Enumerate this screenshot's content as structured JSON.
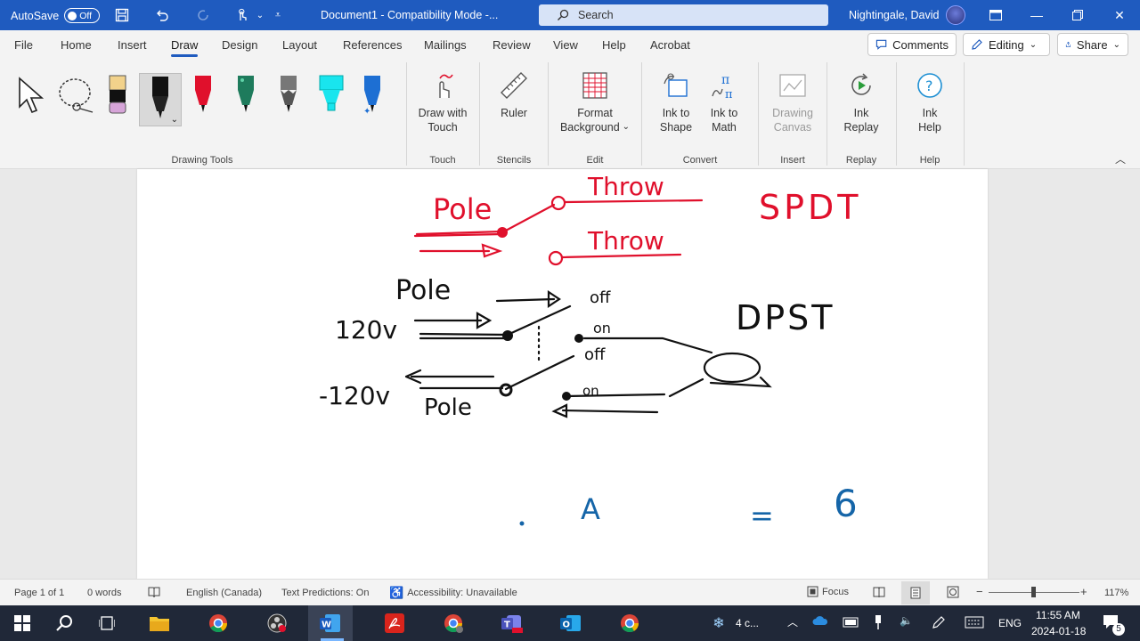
{
  "titlebar": {
    "autosave_label": "AutoSave",
    "autosave_state": "Off",
    "doc_title": "Document1  -  Compatibility Mode  -...",
    "search_placeholder": "Search",
    "user_name": "Nightingale, David"
  },
  "menu": {
    "tabs": [
      "File",
      "Home",
      "Insert",
      "Draw",
      "Design",
      "Layout",
      "References",
      "Mailings",
      "Review",
      "View",
      "Help",
      "Acrobat"
    ],
    "active_tab": "Draw",
    "comments_label": "Comments",
    "editing_label": "Editing",
    "share_label": "Share"
  },
  "ribbon": {
    "groups": {
      "drawing_tools": "Drawing Tools",
      "touch": "Touch",
      "stencils": "Stencils",
      "edit": "Edit",
      "convert": "Convert",
      "insert": "Insert",
      "replay": "Replay",
      "help": "Help"
    },
    "draw_with_touch": [
      "Draw with",
      "Touch"
    ],
    "ruler": "Ruler",
    "format_background": [
      "Format",
      "Background"
    ],
    "ink_to_shape": [
      "Ink to",
      "Shape"
    ],
    "ink_to_math": [
      "Ink to",
      "Math"
    ],
    "drawing_canvas": [
      "Drawing",
      "Canvas"
    ],
    "ink_replay": [
      "Ink",
      "Replay"
    ],
    "ink_help": [
      "Ink",
      "Help"
    ],
    "pen_colors": [
      "#f2c84b",
      "#111111",
      "#e0102c",
      "#1e7b5c",
      "#777777",
      "#19e5ee",
      "#1d6fd3"
    ]
  },
  "document": {
    "ink_text": {
      "pole_red": "Pole",
      "throw_top": "Throw",
      "throw_bottom": "Throw",
      "spdt": "SPDT",
      "pole_black_top": "Pole",
      "v_pos": "120v",
      "v_neg": "-120v",
      "pole_black_bottom": "Pole",
      "off_1": "off",
      "on_1": "on",
      "off_2": "off",
      "on_2": "on",
      "dpst": "DPST",
      "blue_a": "A",
      "blue_eq": "=",
      "blue_6": "6"
    },
    "ink_colors": {
      "red": "#e0102c",
      "black": "#111111",
      "blue": "#1565a8"
    }
  },
  "status": {
    "page": "Page 1 of 1",
    "words": "0 words",
    "language": "English (Canada)",
    "text_predictions": "Text Predictions: On",
    "accessibility": "Accessibility: Unavailable",
    "focus": "Focus",
    "zoom": "117%"
  },
  "taskbar": {
    "weather": "4 c...",
    "language": "ENG",
    "time": "11:55 AM",
    "date": "2024-01-18",
    "notification_count": "5"
  }
}
